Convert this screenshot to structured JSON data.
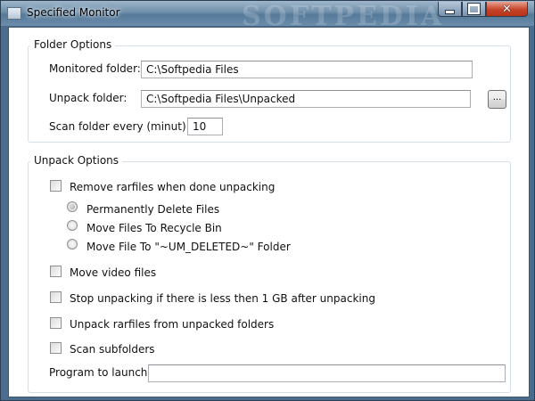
{
  "window": {
    "title": "Specified Monitor",
    "watermark": "SOFTPEDIA",
    "controls": {
      "minimize": "minimize",
      "maximize": "maximize",
      "close": "✕"
    }
  },
  "folder_options": {
    "title": "Folder Options",
    "monitored_label": "Monitored folder:",
    "monitored_value": "C:\\Softpedia Files",
    "unpack_label": "Unpack folder:",
    "unpack_value": "C:\\Softpedia Files\\Unpacked",
    "browse_label": "...",
    "scan_label": "Scan folder every (minut):",
    "scan_value": "10"
  },
  "unpack_options": {
    "title": "Unpack Options",
    "remove_rarfiles": {
      "label": "Remove rarfiles when done unpacking",
      "checked": false
    },
    "delete_modes": [
      {
        "label": "Permanently Delete Files",
        "selected": true
      },
      {
        "label": "Move Files To Recycle Bin",
        "selected": false
      },
      {
        "label": "Move File To \"~UM_DELETED~\" Folder",
        "selected": false
      }
    ],
    "move_video": {
      "label": "Move video files",
      "checked": false
    },
    "stop_unpacking": {
      "label": "Stop unpacking if there is less then 1 GB after unpacking",
      "checked": false
    },
    "unpack_nested": {
      "label": "Unpack rarfiles from unpacked folders",
      "checked": false
    },
    "scan_subfolders": {
      "label": "Scan subfolders",
      "checked": false
    },
    "program_label": "Program to launch:",
    "program_value": ""
  },
  "colors": {
    "window_frame": "#4a6d8d",
    "close_button": "#c6432a"
  }
}
